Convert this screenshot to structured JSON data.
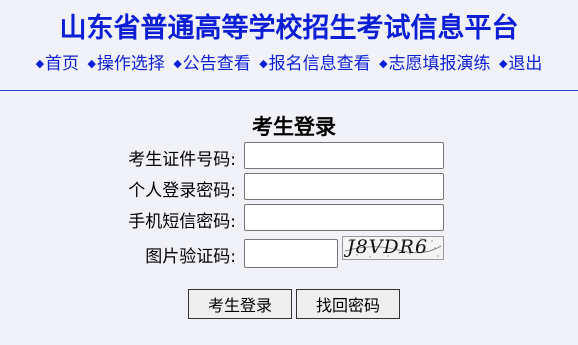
{
  "site": {
    "title": "山东省普通高等学校招生考试信息平台"
  },
  "nav": {
    "bullet": "◆",
    "items": [
      {
        "label": "首页"
      },
      {
        "label": "操作选择"
      },
      {
        "label": "公告查看"
      },
      {
        "label": "报名信息查看"
      },
      {
        "label": "志愿填报演练"
      },
      {
        "label": "退出"
      }
    ]
  },
  "login": {
    "title": "考生登录",
    "fields": {
      "id_label": "考生证件号码:",
      "id_value": "",
      "password_label": "个人登录密码:",
      "password_value": "",
      "sms_label": "手机短信密码:",
      "sms_value": "",
      "captcha_label": "图片验证码:",
      "captcha_value": "",
      "captcha_image_text": "J8VDR6"
    },
    "buttons": {
      "login": "考生登录",
      "recover": "找回密码"
    }
  },
  "colors": {
    "brand_blue": "#0d1fd6",
    "background": "#f1f2f7"
  }
}
